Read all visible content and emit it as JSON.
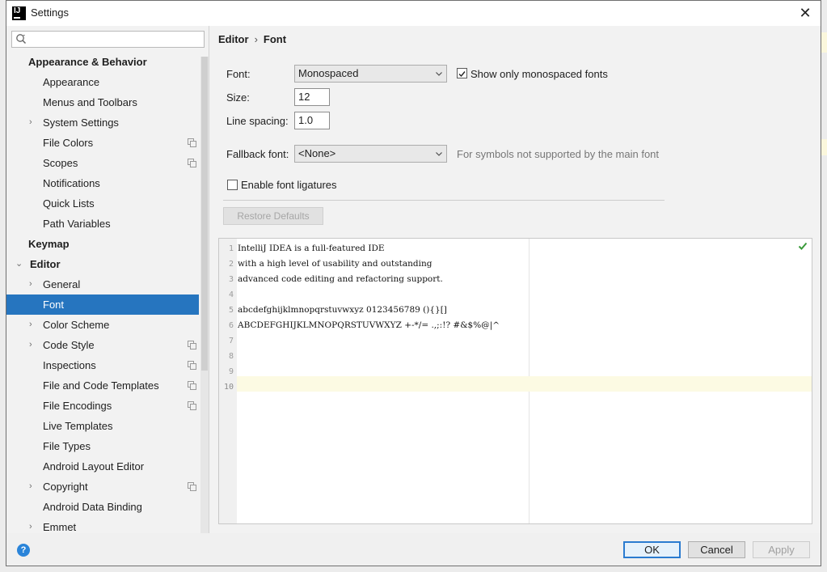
{
  "window": {
    "title": "Settings",
    "app_icon_text": "IJ"
  },
  "search": {
    "placeholder": ""
  },
  "sidebar": {
    "items": [
      {
        "label": "Appearance & Behavior",
        "level": 0,
        "arrow": ""
      },
      {
        "label": "Appearance",
        "level": 1
      },
      {
        "label": "Menus and Toolbars",
        "level": 1
      },
      {
        "label": "System Settings",
        "level": 1,
        "arrow": "›"
      },
      {
        "label": "File Colors",
        "level": 1,
        "copy": true
      },
      {
        "label": "Scopes",
        "level": 1,
        "copy": true
      },
      {
        "label": "Notifications",
        "level": 1
      },
      {
        "label": "Quick Lists",
        "level": 1
      },
      {
        "label": "Path Variables",
        "level": 1
      },
      {
        "label": "Keymap",
        "level": 0
      },
      {
        "label": "Editor",
        "level": 0,
        "arrow": "⌄"
      },
      {
        "label": "General",
        "level": 1,
        "arrow": "›"
      },
      {
        "label": "Font",
        "level": 1,
        "selected": true
      },
      {
        "label": "Color Scheme",
        "level": 1,
        "arrow": "›"
      },
      {
        "label": "Code Style",
        "level": 1,
        "arrow": "›",
        "copy": true
      },
      {
        "label": "Inspections",
        "level": 1,
        "copy": true
      },
      {
        "label": "File and Code Templates",
        "level": 1,
        "copy": true
      },
      {
        "label": "File Encodings",
        "level": 1,
        "copy": true
      },
      {
        "label": "Live Templates",
        "level": 1
      },
      {
        "label": "File Types",
        "level": 1
      },
      {
        "label": "Android Layout Editor",
        "level": 1
      },
      {
        "label": "Copyright",
        "level": 1,
        "arrow": "›",
        "copy": true
      },
      {
        "label": "Android Data Binding",
        "level": 1
      },
      {
        "label": "Emmet",
        "level": 1,
        "arrow": "›"
      }
    ]
  },
  "breadcrumb": {
    "parent": "Editor",
    "separator": "›",
    "current": "Font"
  },
  "font_settings": {
    "font_label": "Font:",
    "font_value": "Monospaced",
    "show_mono_label": "Show only monospaced fonts",
    "show_mono_checked": true,
    "size_label": "Size:",
    "size_value": "12",
    "line_spacing_label": "Line spacing:",
    "line_spacing_value": "1.0",
    "fallback_label": "Fallback font:",
    "fallback_value": "<None>",
    "fallback_hint": "For symbols not supported by the main font",
    "ligatures_label": "Enable font ligatures",
    "ligatures_checked": false,
    "restore_label": "Restore Defaults"
  },
  "preview": {
    "lines": [
      {
        "n": "1",
        "text": "IntelliJ IDEA is a full-featured IDE"
      },
      {
        "n": "2",
        "text": "with a high level of usability and outstanding"
      },
      {
        "n": "3",
        "text": "advanced code editing and refactoring support."
      },
      {
        "n": "4",
        "text": ""
      },
      {
        "n": "5",
        "text": "abcdefghijklmnopqrstuvwxyz 0123456789 (){}[]"
      },
      {
        "n": "6",
        "text": "ABCDEFGHIJKLMNOPQRSTUVWXYZ +-*/= .,;:!? #&$%@|^"
      },
      {
        "n": "7",
        "text": ""
      },
      {
        "n": "8",
        "text": ""
      },
      {
        "n": "9",
        "text": ""
      },
      {
        "n": "10",
        "text": ""
      }
    ],
    "current_line": "10"
  },
  "footer": {
    "ok_label": "OK",
    "cancel_label": "Cancel",
    "apply_label": "Apply",
    "help_glyph": "?"
  },
  "colors": {
    "selection": "#2675bf",
    "accent": "#2a84d9"
  }
}
